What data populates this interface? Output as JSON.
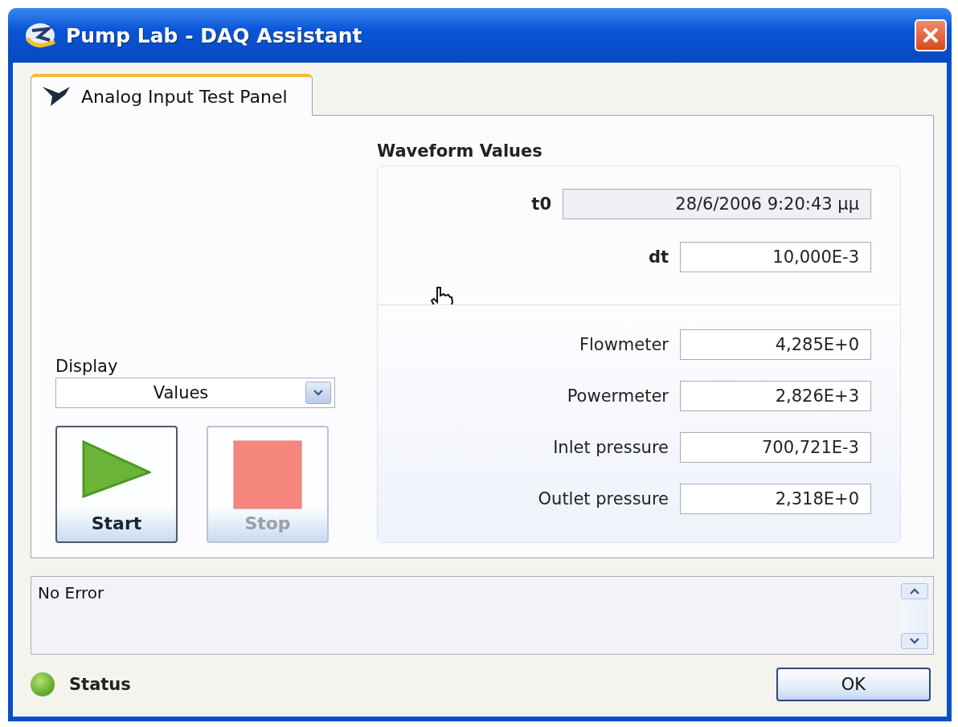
{
  "window": {
    "title": "Pump Lab - DAQ Assistant"
  },
  "tabs": [
    {
      "label": "Analog Input Test Panel",
      "selected": true
    }
  ],
  "display": {
    "label": "Display",
    "value": "Values"
  },
  "buttons": [
    {
      "kind": "start",
      "label": "Start",
      "disabled": false
    },
    {
      "kind": "stop",
      "label": "Stop",
      "disabled": true
    }
  ],
  "waveform": {
    "title": "Waveform Values",
    "timing": [
      {
        "label": "t0",
        "value": "28/6/2006 9:20:43 μμ",
        "readonly": true
      },
      {
        "label": "dt",
        "value": "10,000E-3",
        "readonly": false
      }
    ],
    "channels": [
      {
        "name": "Flowmeter",
        "value": "4,285E+0"
      },
      {
        "name": "Powermeter",
        "value": "2,826E+3"
      },
      {
        "name": "Inlet pressure",
        "value": "700,721E-3"
      },
      {
        "name": "Outlet pressure",
        "value": "2,318E+0"
      }
    ]
  },
  "error_box": {
    "text": "No Error"
  },
  "status": {
    "label": "Status",
    "on": true
  },
  "ok_button": {
    "label": "OK"
  }
}
